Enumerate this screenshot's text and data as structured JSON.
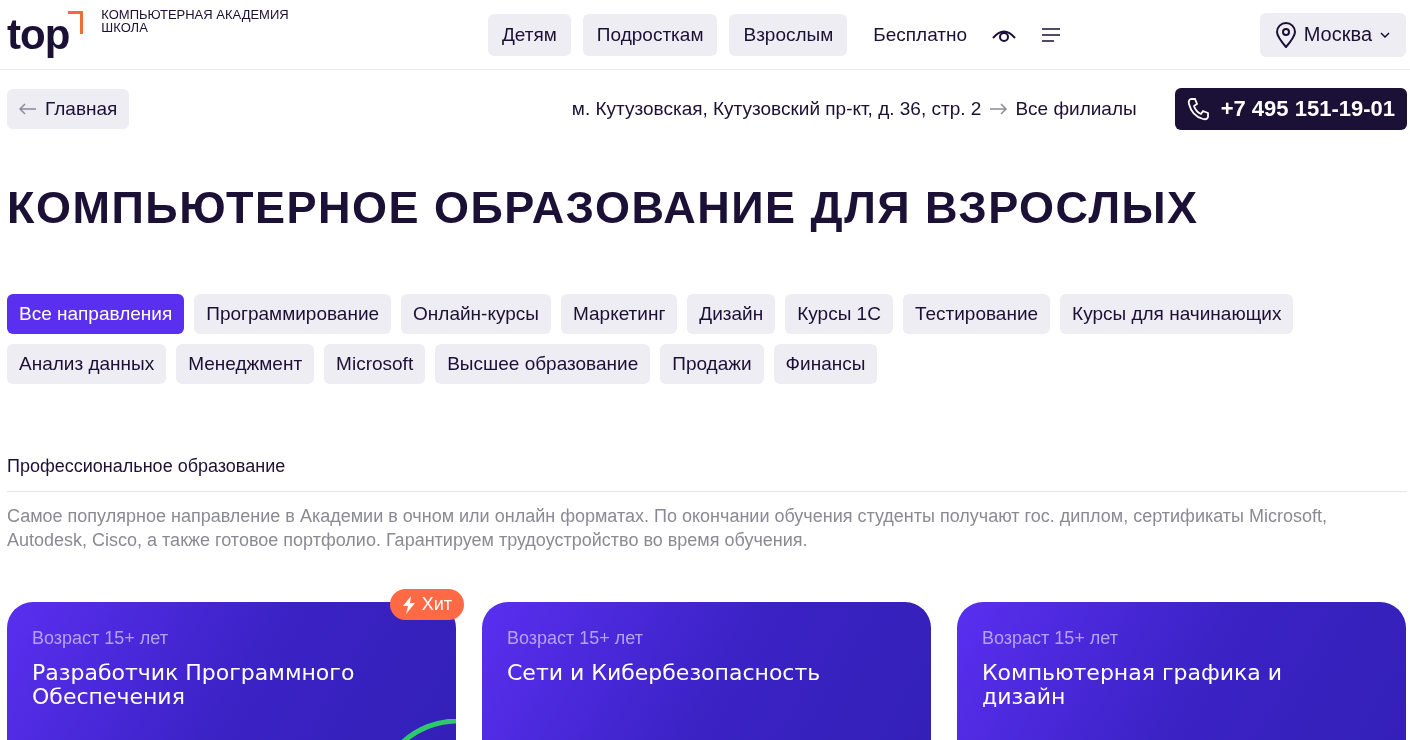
{
  "logo": {
    "mark": "top",
    "subtitle_lines": [
      "КОМПЬЮТЕРНАЯ АКАДЕМИЯ",
      "ШКОЛА"
    ]
  },
  "nav": [
    {
      "label": "Детям",
      "kind": "pill"
    },
    {
      "label": "Подросткам",
      "kind": "pill"
    },
    {
      "label": "Взрослым",
      "kind": "pill"
    },
    {
      "label": "Бесплатно",
      "kind": "plain"
    }
  ],
  "city": "Москва",
  "back_link": "Главная",
  "address": "м. Кутузовская, Кутузовский пр-кт, д. 36, стр. 2",
  "branches_link": "Все филиалы",
  "phone": "+7 495 151-19-01",
  "heading": "КОМПЬЮТЕРНОЕ ОБРАЗОВАНИЕ ДЛЯ ВЗРОСЛЫХ",
  "filters": [
    {
      "label": "Все направления",
      "selected": true
    },
    {
      "label": "Программирование",
      "selected": false
    },
    {
      "label": "Онлайн-курсы",
      "selected": false
    },
    {
      "label": "Маркетинг",
      "selected": false
    },
    {
      "label": "Дизайн",
      "selected": false
    },
    {
      "label": "Курсы 1С",
      "selected": false
    },
    {
      "label": "Тестирование",
      "selected": false
    },
    {
      "label": "Курсы для начинающих",
      "selected": false
    },
    {
      "label": "Анализ данных",
      "selected": false
    },
    {
      "label": "Менеджмент",
      "selected": false
    },
    {
      "label": "Microsoft",
      "selected": false
    },
    {
      "label": "Высшее образование",
      "selected": false
    },
    {
      "label": "Продажи",
      "selected": false
    },
    {
      "label": "Финансы",
      "selected": false
    }
  ],
  "section": {
    "title": "Профессиональное образование",
    "description": "Самое популярное направление в Академии в очном или онлайн форматах. По окончании обучения студенты получают гос. диплом, сертификаты Microsoft, Autodesk, Cisco, а также готовое портфолио. Гарантируем трудоустройство во время обучения."
  },
  "cards": [
    {
      "age": "Возраст 15+ лет",
      "title": "Разработчик Программного Обеспечения",
      "badge": "Хит"
    },
    {
      "age": "Возраст 15+ лет",
      "title": "Сети и Кибербезопасность"
    },
    {
      "age": "Возраст 15+ лет",
      "title": "Компьютерная графика и дизайн"
    }
  ]
}
